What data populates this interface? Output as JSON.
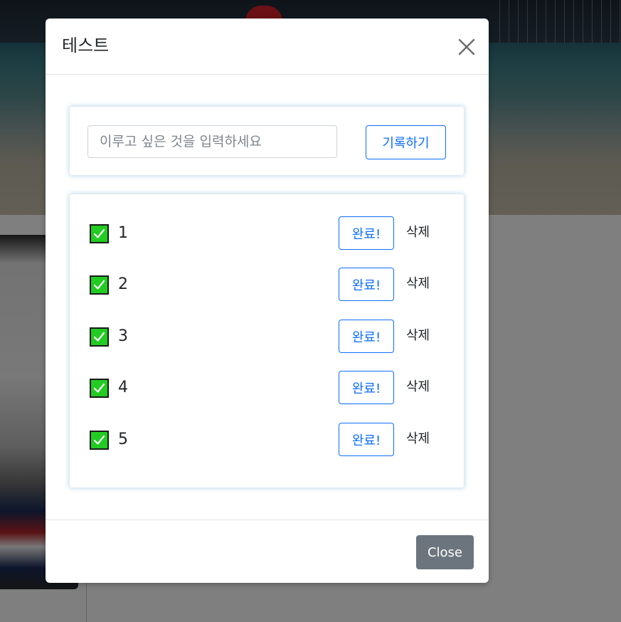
{
  "modal": {
    "title": "테스트",
    "close_footer_label": "Close"
  },
  "todo_form": {
    "input_value": "",
    "input_placeholder": "이루고 싶은 것을 입력하세요",
    "submit_label": "기록하기"
  },
  "todos": [
    {
      "text": "1",
      "checked": true,
      "done_label": "완료!",
      "delete_label": "삭제"
    },
    {
      "text": "2",
      "checked": true,
      "done_label": "완료!",
      "delete_label": "삭제"
    },
    {
      "text": "3",
      "checked": true,
      "done_label": "완료!",
      "delete_label": "삭제"
    },
    {
      "text": "4",
      "checked": true,
      "done_label": "완료!",
      "delete_label": "삭제"
    },
    {
      "text": "5",
      "checked": true,
      "done_label": "완료!",
      "delete_label": "삭제"
    }
  ],
  "colors": {
    "accent": "#0d6efd",
    "checkbox": "#22cc22",
    "secondary_button": "#6c757d"
  },
  "icons": {
    "close": "close-icon",
    "check": "checkmark-icon"
  }
}
